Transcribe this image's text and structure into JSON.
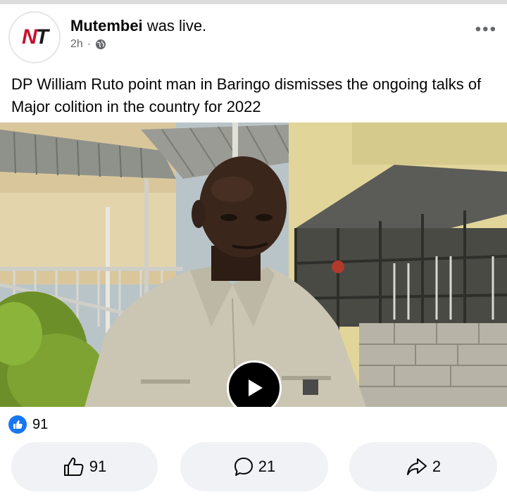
{
  "post": {
    "author": "Mutembei",
    "status": "was live.",
    "time": "2h",
    "separator": "·",
    "caption": "DP William Ruto point man in Baringo dismisses the ongoing talks of Major colition  in the country for 2022",
    "avatar": {
      "letter_a": "N",
      "letter_b": "T"
    }
  },
  "icons": {
    "more": "more-options-icon",
    "privacy": "globe-icon",
    "play": "play-icon",
    "like": "thumbs-up-icon",
    "comment": "comment-icon",
    "share": "share-icon"
  },
  "reactions": {
    "count": "91"
  },
  "actions": {
    "like_count": "91",
    "comment_count": "21",
    "share_count": "2"
  },
  "colors": {
    "accent": "#1877f2",
    "brand_red": "#c8102e"
  }
}
